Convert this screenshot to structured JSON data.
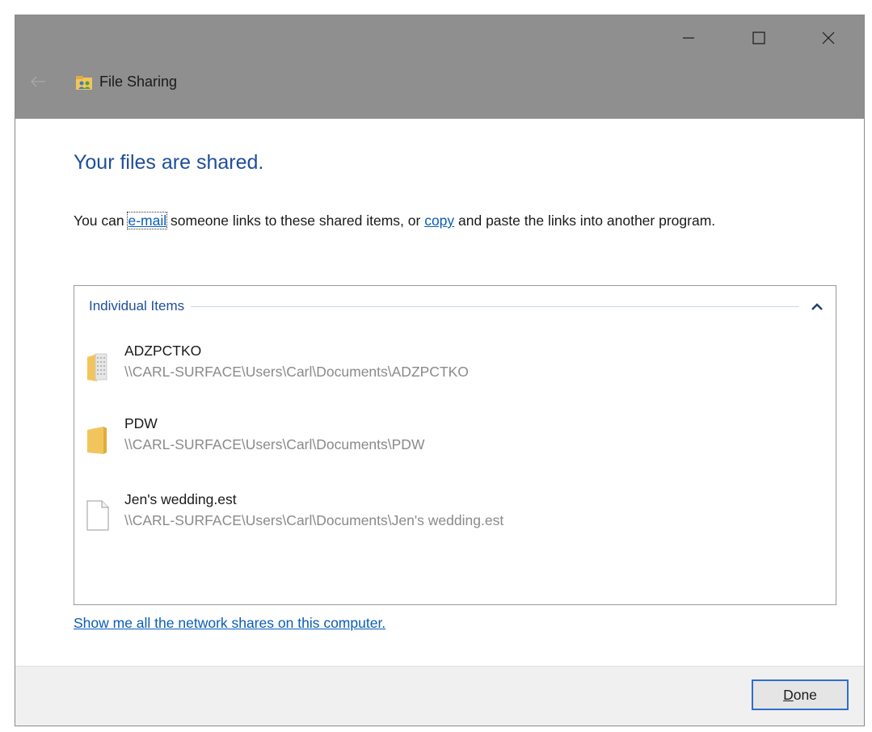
{
  "window": {
    "title": "File Sharing",
    "caption_buttons": [
      "minimize-icon",
      "maximize-icon",
      "close-icon"
    ],
    "back_icon": "back-arrow-icon",
    "app_icon": "file-sharing-icon"
  },
  "main": {
    "heading": "Your files are shared.",
    "description": {
      "prefix": "You can ",
      "email_link": "e-mail",
      "middle": " someone links to these shared items, or ",
      "copy_link": "copy",
      "suffix": " and paste the links into another program."
    }
  },
  "items_group": {
    "label": "Individual Items",
    "collapse_icon": "chevron-up-icon",
    "items": [
      {
        "name": "ADZPCTKO",
        "path": "\\\\CARL-SURFACE\\Users\\Carl\\Documents\\ADZPCTKO",
        "icon": "folder-with-files-icon"
      },
      {
        "name": "PDW",
        "path": "\\\\CARL-SURFACE\\Users\\Carl\\Documents\\PDW",
        "icon": "folder-icon"
      },
      {
        "name": "Jen's wedding.est",
        "path": "\\\\CARL-SURFACE\\Users\\Carl\\Documents\\Jen's wedding.est",
        "icon": "file-icon"
      }
    ]
  },
  "network_link": "Show me all the network shares on this computer.",
  "footer": {
    "done_label_underlined": "D",
    "done_label_rest": "one"
  },
  "colors": {
    "titlebar": "#8f8f8f",
    "heading": "#1f4e9c",
    "link": "#0a5db6",
    "folder": "#f2c55c",
    "footer": "#f0f0f0"
  }
}
